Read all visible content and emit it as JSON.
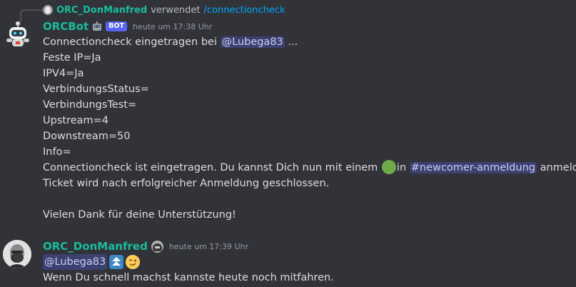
{
  "reply": {
    "author": "ORC_DonManfred",
    "verb": "verwendet",
    "command": "/connectioncheck"
  },
  "bot_message": {
    "author": "ORCBot",
    "role_icon": "robot-emoji-icon",
    "bot_tag": "BOT",
    "timestamp": "heute um 17:38 Uhr",
    "intro_text": "Connectioncheck eingetragen bei ",
    "mention": "@Lubega83",
    "intro_suffix": " ...",
    "lines": [
      "Feste IP=Ja",
      "IPV4=Ja",
      "VerbindungsStatus=",
      "VerbindungsTest=",
      "Upstream=4",
      "Downstream=50",
      "Info="
    ],
    "final_part1": "Connectioncheck ist eingetragen. Du kannst Dich nun mit einem ",
    "final_part2": "in ",
    "channel": "#newcomer-anmeldung",
    "final_part3": " anmelden.",
    "ticket_line": "Ticket wird nach erfolgreicher Anmeldung geschlossen.",
    "thanks": "Vielen Dank für deine Unterstützung!"
  },
  "user_message": {
    "author": "ORC_DonManfred",
    "badge": "helmet-badge-icon",
    "timestamp": "heute um 17:39 Uhr",
    "mention": "@Lubega83",
    "emojis": [
      "arrow-double-up-icon",
      "wink-face-icon"
    ],
    "text": "Wenn Du schnell machst kannste heute noch mitfahren."
  },
  "colors": {
    "background": "#313338",
    "username": "#1abc9c",
    "mention_bg": "#3c4270",
    "link": "#00a8fc",
    "bot_tag": "#5865f2"
  }
}
